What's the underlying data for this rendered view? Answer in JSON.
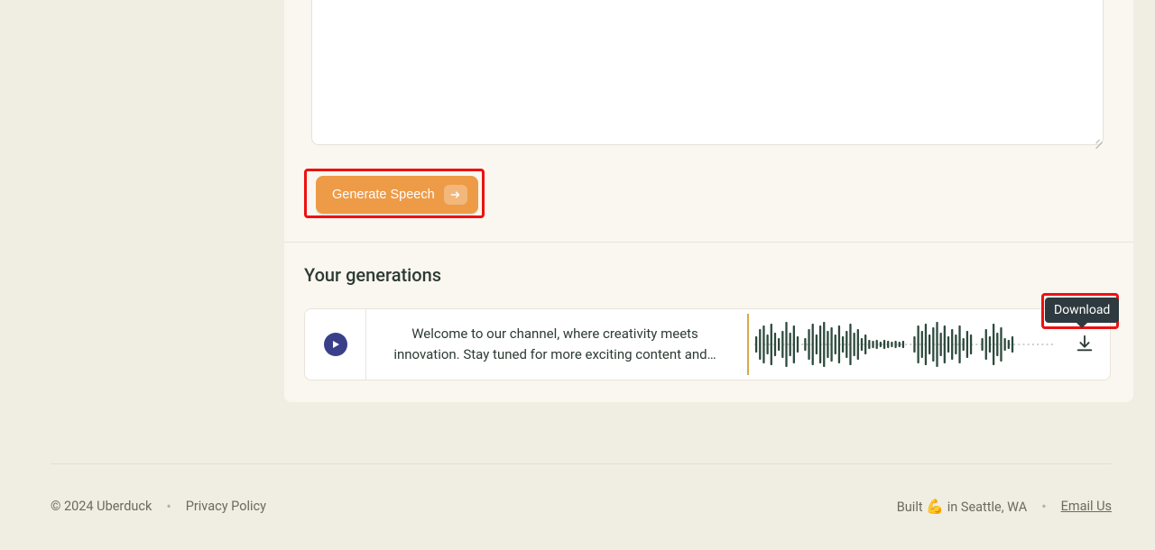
{
  "actions": {
    "generate_label": "Generate Speech"
  },
  "generations": {
    "title": "Your generations",
    "items": [
      {
        "text": "Welcome to our channel, where creativity meets innovation. Stay tuned for more exciting content and…"
      }
    ]
  },
  "tooltip": {
    "download": "Download"
  },
  "footer": {
    "copyright": "© 2024 Uberduck",
    "privacy": "Privacy Policy",
    "built_prefix": "Built ",
    "built_suffix": " in Seattle, WA",
    "email": "Email Us"
  }
}
